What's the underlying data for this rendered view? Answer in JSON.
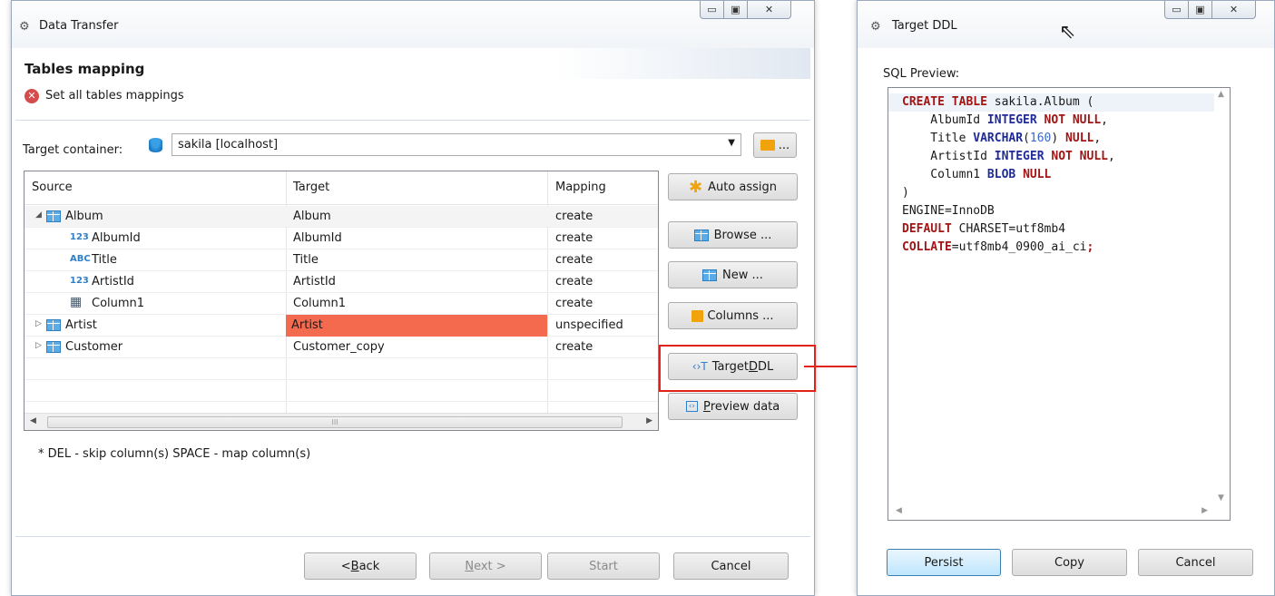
{
  "data_transfer": {
    "title": "Data Transfer",
    "page_title": "Tables mapping",
    "error_message": "Set all tables mappings",
    "target_container_label": "Target container:",
    "target_container_value": "sakila  [localhost]",
    "folder_button_label": "...",
    "columns": [
      "Source",
      "Target",
      "Mapping"
    ],
    "rows": [
      {
        "source": "Album",
        "target": "Album",
        "mapping": "create",
        "level": 0,
        "icon": "table-icon",
        "twisty": "◢"
      },
      {
        "source": "AlbumId",
        "target": "AlbumId",
        "mapping": "create",
        "level": 1,
        "icon": "123",
        "twisty": ""
      },
      {
        "source": "Title",
        "target": "Title",
        "mapping": "create",
        "level": 1,
        "icon": "ABC",
        "twisty": ""
      },
      {
        "source": "ArtistId",
        "target": "ArtistId",
        "mapping": "create",
        "level": 1,
        "icon": "123",
        "twisty": ""
      },
      {
        "source": "Column1",
        "target": "Column1",
        "mapping": "create",
        "level": 1,
        "icon": "▦",
        "twisty": ""
      },
      {
        "source": "Artist",
        "target": "Artist",
        "mapping": "unspecified",
        "level": 0,
        "icon": "table-icon",
        "twisty": "▷"
      },
      {
        "source": "Customer",
        "target": "Customer_copy",
        "mapping": "create",
        "level": 0,
        "icon": "table-icon",
        "twisty": "▷"
      }
    ],
    "scroll_thumb_label": "III",
    "side_buttons": {
      "auto_assign": "Auto assign",
      "browse": "Browse ...",
      "new": "New ...",
      "columns": "Columns ...",
      "target_ddl_pre": "Target ",
      "target_ddl_u": "D",
      "target_ddl_post": "DL",
      "preview_u": "P",
      "preview_post": "review data"
    },
    "hint": "* DEL - skip column(s)  SPACE - map column(s)",
    "footer": {
      "back_pre": "< ",
      "back_u": "B",
      "back_post": "ack",
      "next_u": "N",
      "next_post": "ext >",
      "start": "Start",
      "cancel": "Cancel"
    },
    "colors": {
      "error_cell": "#f36a4e",
      "callout": "#e2231a"
    }
  },
  "target_ddl": {
    "title": "Target DDL",
    "sql_preview_label": "SQL Preview:",
    "sql_lines": [
      [
        [
          "kw",
          "CREATE TABLE"
        ],
        [
          "plain",
          " sakila.Album ("
        ]
      ],
      [
        [
          "plain",
          "    AlbumId "
        ],
        [
          "kw2",
          "INTEGER"
        ],
        [
          "plain",
          " "
        ],
        [
          "kw",
          "NOT NULL"
        ],
        [
          "plain",
          ","
        ]
      ],
      [
        [
          "plain",
          "    Title "
        ],
        [
          "kw2",
          "VARCHAR"
        ],
        [
          "plain",
          "("
        ],
        [
          "num",
          "160"
        ],
        [
          "plain",
          ") "
        ],
        [
          "kw",
          "NULL"
        ],
        [
          "plain",
          ","
        ]
      ],
      [
        [
          "plain",
          "    ArtistId "
        ],
        [
          "kw2",
          "INTEGER"
        ],
        [
          "plain",
          " "
        ],
        [
          "kw",
          "NOT NULL"
        ],
        [
          "plain",
          ","
        ]
      ],
      [
        [
          "plain",
          "    Column1 "
        ],
        [
          "kw2",
          "BLOB"
        ],
        [
          "plain",
          " "
        ],
        [
          "kw",
          "NULL"
        ]
      ],
      [
        [
          "plain",
          ")"
        ]
      ],
      [
        [
          "plain",
          "ENGINE=InnoDB"
        ]
      ],
      [
        [
          "kw",
          "DEFAULT"
        ],
        [
          "plain",
          " CHARSET=utf8mb4"
        ]
      ],
      [
        [
          "kw",
          "COLLATE"
        ],
        [
          "plain",
          "=utf8mb4_0900_ai_ci"
        ],
        [
          "kw",
          ";"
        ]
      ]
    ],
    "buttons": {
      "persist": "Persist",
      "copy": "Copy",
      "cancel": "Cancel"
    }
  }
}
